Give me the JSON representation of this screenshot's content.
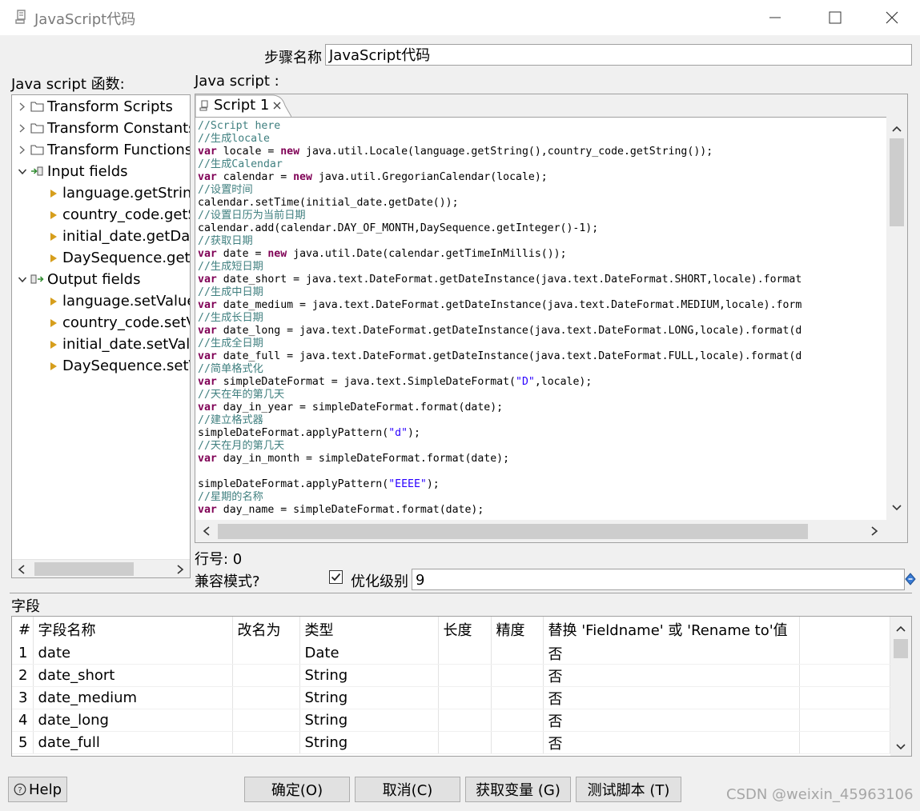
{
  "window": {
    "title": "JavaScript代码"
  },
  "step": {
    "label": "步骤名称",
    "value": "JavaScript代码"
  },
  "functions": {
    "label": "Java script 函数:",
    "folders": [
      "Transform Scripts",
      "Transform Constants",
      "Transform Functions"
    ],
    "input_label": "Input fields",
    "input_items": [
      "language.getString",
      "country_code.getS",
      "initial_date.getDat",
      "DaySequence.getIn"
    ],
    "output_label": "Output fields",
    "output_items": [
      "language.setValue",
      "country_code.setVa",
      "initial_date.setValu",
      "DaySequence.setV"
    ]
  },
  "script": {
    "label": "Java script :",
    "tab": "Script 1",
    "lines": [
      "//Script here",
      "//生成locale",
      "var locale = new java.util.Locale(language.getString(),country_code.getString());",
      "//生成Calendar",
      "var calendar = new java.util.GregorianCalendar(locale);",
      "//设置时间",
      "calendar.setTime(initial_date.getDate());",
      "//设置日历为当前日期",
      "calendar.add(calendar.DAY_OF_MONTH,DaySequence.getInteger()-1);",
      "//获取日期",
      "var date = new java.util.Date(calendar.getTimeInMillis());",
      "//生成短日期",
      "var date_short = java.text.DateFormat.getDateInstance(java.text.DateFormat.SHORT,locale).format",
      "//生成中日期",
      "var date_medium = java.text.DateFormat.getDateInstance(java.text.DateFormat.MEDIUM,locale).form",
      "//生成长日期",
      "var date_long = java.text.DateFormat.getDateInstance(java.text.DateFormat.LONG,locale).format(d",
      "//生成全日期",
      "var date_full = java.text.DateFormat.getDateInstance(java.text.DateFormat.FULL,locale).format(d",
      "//简单格式化",
      "var simpleDateFormat = java.text.SimpleDateFormat(\"D\",locale);",
      "//天在年的第几天",
      "var day_in_year = simpleDateFormat.format(date);",
      "//建立格式器",
      "simpleDateFormat.applyPattern(\"d\");",
      "//天在月的第几天",
      "var day_in_month = simpleDateFormat.format(date);",
      "",
      "simpleDateFormat.applyPattern(\"EEEE\");",
      "//星期的名称",
      "var day_name = simpleDateFormat.format(date);"
    ]
  },
  "line_number": "行号: 0",
  "compat_label": "兼容模式?",
  "optimization": {
    "label": "优化级别",
    "value": "9",
    "checked": true
  },
  "fields": {
    "label": "字段",
    "columns": [
      "#",
      "字段名称",
      "改名为",
      "类型",
      "长度",
      "精度",
      "替换 'Fieldname' 或 'Rename to'值"
    ],
    "rows": [
      [
        "1",
        "date",
        "",
        "Date",
        "",
        "",
        "否"
      ],
      [
        "2",
        "date_short",
        "",
        "String",
        "",
        "",
        "否"
      ],
      [
        "3",
        "date_medium",
        "",
        "String",
        "",
        "",
        "否"
      ],
      [
        "4",
        "date_long",
        "",
        "String",
        "",
        "",
        "否"
      ],
      [
        "5",
        "date_full",
        "",
        "String",
        "",
        "",
        "否"
      ]
    ]
  },
  "buttons": {
    "help": "Help",
    "ok": "确定(O)",
    "cancel": "取消(C)",
    "get_vars": "获取变量 (G)",
    "test": "测试脚本 (T)"
  },
  "watermark": "CSDN @weixin_45963106",
  "colors": {
    "comment": "#3f7f7f",
    "keyword": "#7f0055",
    "string": "#2a00ff",
    "folder_arrow": "#d69e1c"
  }
}
